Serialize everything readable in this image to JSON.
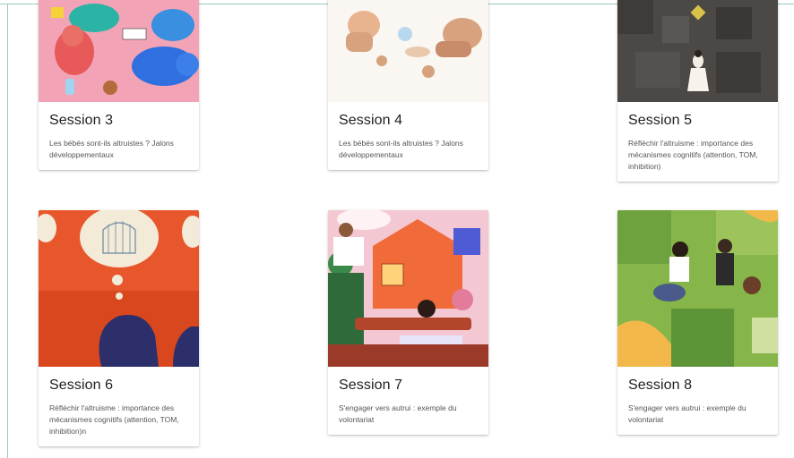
{
  "sessions": [
    {
      "title": "Session 3",
      "description": "Les bébés sont-ils altruistes ? Jalons développementaux",
      "image": "illustration-babies-pink"
    },
    {
      "title": "Session 4",
      "description": "Les bébés sont-ils altruistes ? Jalons développementaux",
      "image": "illustration-children-playing"
    },
    {
      "title": "Session 5",
      "description": "Réfléchir l'altruisme : importance des mécanismes cognitifs (attention, TOM, inhibition)",
      "image": "illustration-maze-gray"
    },
    {
      "title": "Session 6",
      "description": "Réfléchir l'altruisme : importance des mécanismes cognitifs (attention, TOM, inhibition)n",
      "image": "illustration-thought-bubble-cage"
    },
    {
      "title": "Session 7",
      "description": "S'engager vers autrui : exemple du volontariat",
      "image": "illustration-neighbours-house"
    },
    {
      "title": "Session 8",
      "description": "S'engager vers autrui : exemple du volontariat",
      "image": "illustration-puzzle-garden"
    }
  ]
}
